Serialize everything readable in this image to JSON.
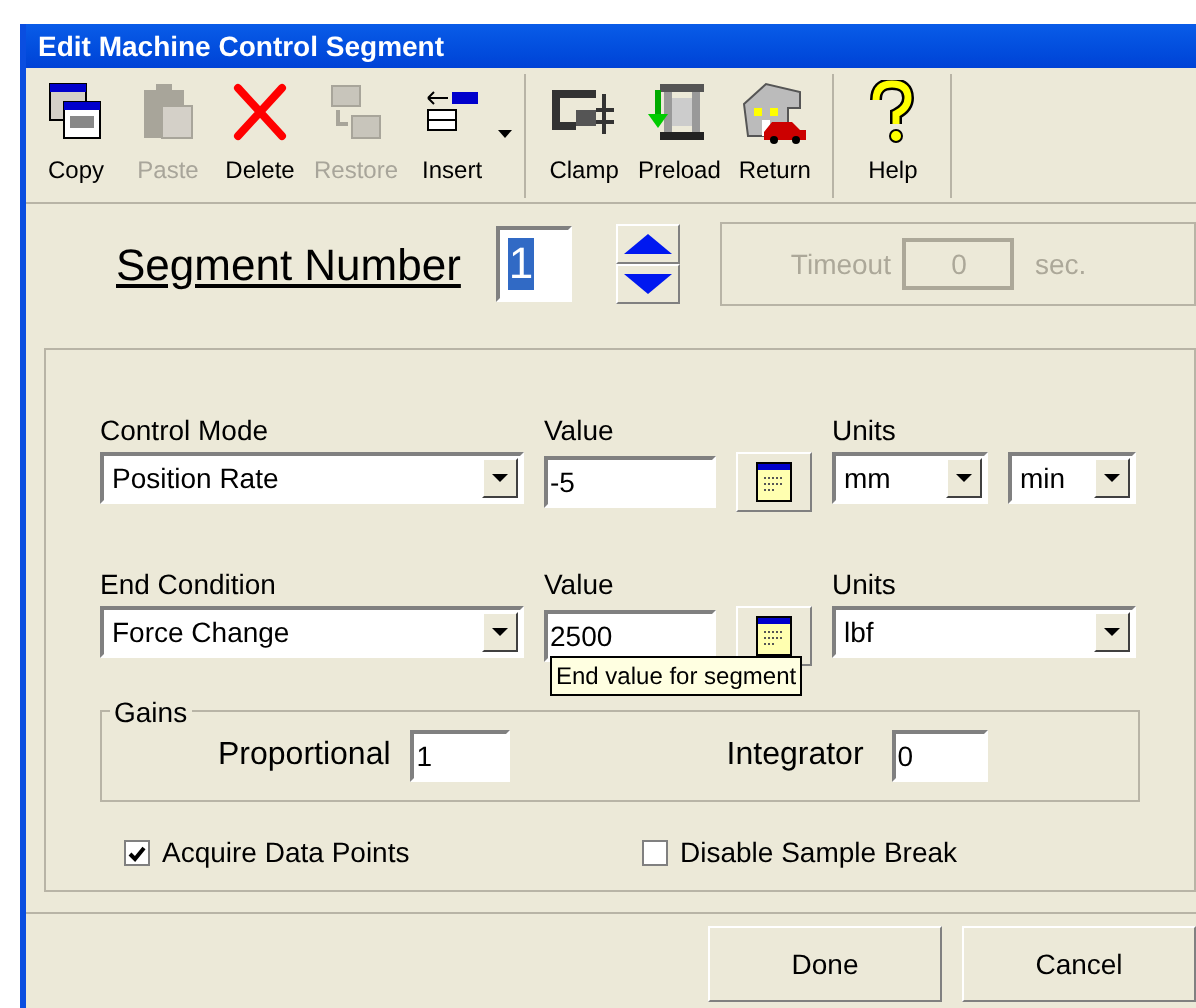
{
  "window": {
    "title": "Edit Machine Control Segment"
  },
  "toolbar": {
    "groups": [
      [
        {
          "label": "Copy",
          "disabled": false,
          "dropdown": false
        },
        {
          "label": "Paste",
          "disabled": true,
          "dropdown": false
        },
        {
          "label": "Delete",
          "disabled": false,
          "dropdown": false
        },
        {
          "label": "Restore",
          "disabled": true,
          "dropdown": false
        },
        {
          "label": "Insert",
          "disabled": false,
          "dropdown": true
        }
      ],
      [
        {
          "label": "Clamp",
          "disabled": false,
          "dropdown": false
        },
        {
          "label": "Preload",
          "disabled": false,
          "dropdown": false
        },
        {
          "label": "Return",
          "disabled": false,
          "dropdown": false
        }
      ],
      [
        {
          "label": "Help",
          "disabled": false,
          "dropdown": false
        }
      ]
    ]
  },
  "segment": {
    "label": "Segment Number",
    "value": "1",
    "selected": true
  },
  "timeout": {
    "label": "Timeout",
    "value": "0",
    "unit": "sec.",
    "disabled": true
  },
  "control_mode": {
    "label": "Control Mode",
    "value": "Position Rate",
    "value_label": "Value",
    "amount": "-5",
    "units_label": "Units",
    "units": [
      "mm",
      "min"
    ]
  },
  "end_condition": {
    "label": "End Condition",
    "value": "Force Change",
    "value_label": "Value",
    "amount": "2500",
    "units_label": "Units",
    "units": [
      "lbf"
    ]
  },
  "tooltip": "End value for segment",
  "gains": {
    "title": "Gains",
    "proportional": {
      "label": "Proportional",
      "value": "1"
    },
    "integrator": {
      "label": "Integrator",
      "value": "0"
    }
  },
  "checkboxes": [
    {
      "label": "Acquire Data Points",
      "checked": true
    },
    {
      "label": "Disable Sample Break",
      "checked": false
    }
  ],
  "buttons": [
    "Done",
    "Cancel"
  ]
}
